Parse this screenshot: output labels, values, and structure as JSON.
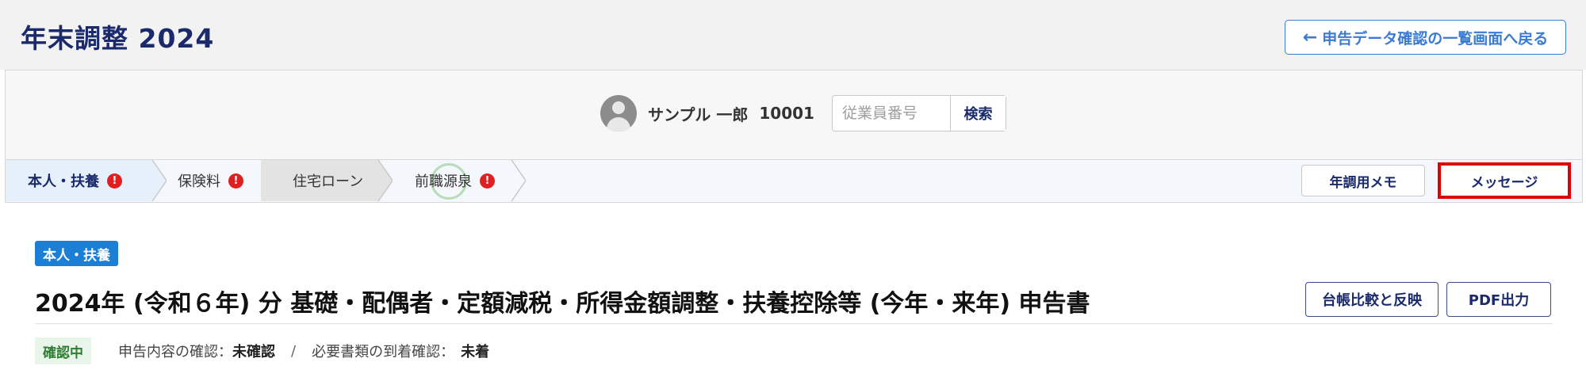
{
  "app": {
    "title": "年末調整 2024",
    "back_label": "申告データ確認の一覧画面へ戻る"
  },
  "employee": {
    "name": "サンプル 一郎",
    "id": "10001",
    "search_placeholder": "従業員番号",
    "search_button": "検索"
  },
  "tabs": [
    {
      "label": "本人・扶養",
      "warning": true,
      "active": true
    },
    {
      "label": "保険料",
      "warning": true,
      "active": false
    },
    {
      "label": "住宅ローン",
      "warning": false,
      "active": false
    },
    {
      "label": "前職源泉",
      "warning": true,
      "active": false
    }
  ],
  "tab_actions": {
    "memo_label": "年調用メモ",
    "message_label": "メッセージ"
  },
  "section": {
    "badge": "本人・扶養",
    "title": "2024年 (令和６年) 分 基礎・配偶者・定額減税・所得金額調整・扶養控除等 (今年・来年) 申告書",
    "compare_button": "台帳比較と反映",
    "pdf_button": "PDF出力"
  },
  "status": {
    "chip": "確認中",
    "content_check_label": "申告内容の確認：",
    "content_check_value": "未確認",
    "separator": "/",
    "docs_check_label": "必要書類の到着確認：",
    "docs_check_value": "未着"
  },
  "colors": {
    "primary": "#1a2a6c",
    "accent_blue": "#1c7fd6",
    "warning_red": "#e02020",
    "highlight_red": "#e00000",
    "status_green": "#2e7d32"
  },
  "icons": {
    "back": "arrow-left-icon",
    "avatar": "user-avatar-icon",
    "warning": "exclamation-icon"
  },
  "warning_symbol": "!"
}
